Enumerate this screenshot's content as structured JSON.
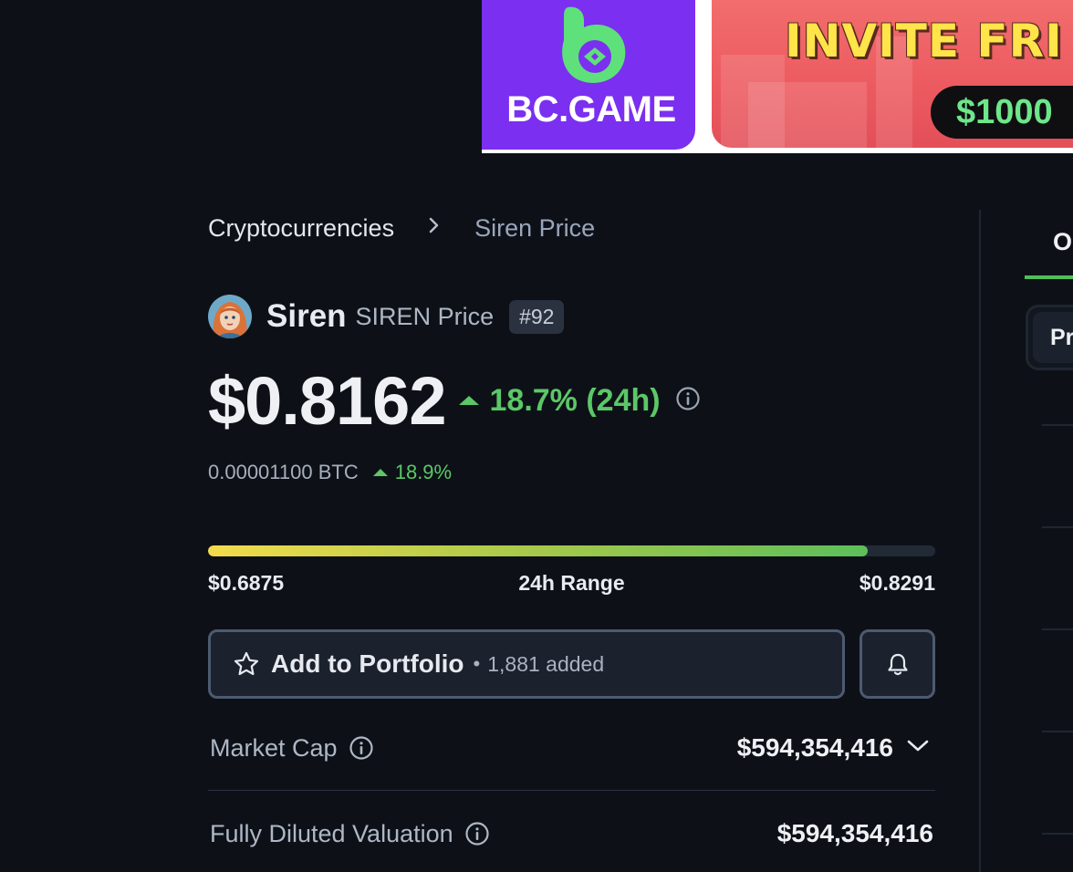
{
  "ad": {
    "brand": "BC.GAME",
    "headline": "INVITE FRI",
    "amount": "$1000",
    "colors": {
      "brand_bg": "#7b2ff0",
      "logo_green": "#5ee07a",
      "art_bg": "#ec5a60",
      "headline": "#ffe44a",
      "amount": "#6ee68a"
    }
  },
  "breadcrumb": {
    "items": [
      {
        "label": "Cryptocurrencies"
      },
      {
        "label": "Siren Price"
      }
    ],
    "separator_icon": "chevron-right-icon"
  },
  "coin": {
    "name": "Siren",
    "symbol_label": "SIREN Price",
    "rank": "#92",
    "avatar_icon": "siren-avatar-icon"
  },
  "price": {
    "value": "$0.8162",
    "change": "18.7% (24h)",
    "direction": "up",
    "btc_value": "0.00001100 BTC",
    "btc_change": "18.9%"
  },
  "range": {
    "low": "$0.6875",
    "title": "24h Range",
    "high": "$0.8291",
    "position_fraction": 0.907
  },
  "actions": {
    "portfolio_label": "Add to Portfolio",
    "portfolio_separator": "•",
    "portfolio_count": "1,881 added",
    "star_icon": "star-icon",
    "bell_icon": "bell-icon"
  },
  "stats": [
    {
      "label": "Market Cap",
      "value": "$594,354,416",
      "expandable": true
    },
    {
      "label": "Fully Diluted Valuation",
      "value": "$594,354,416",
      "expandable": false
    }
  ],
  "right_panel": {
    "tab_label": "O",
    "box_label": "Pr"
  },
  "colors": {
    "background": "#0d1117",
    "positive": "#5cc768",
    "accent_tab": "#4fbf5a",
    "button_border": "#4d5a70"
  }
}
